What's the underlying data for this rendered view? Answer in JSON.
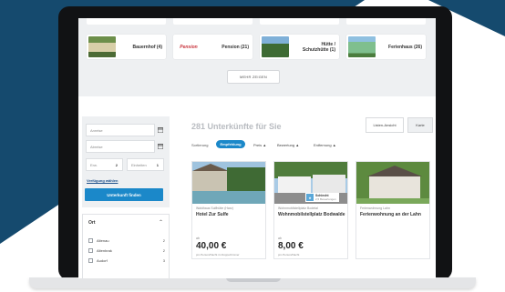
{
  "colors": {
    "navy": "#154a6e",
    "accent": "#1b88c9",
    "panel": "#eef0f2"
  },
  "categories": [
    {
      "label": "Bauernhof (4)",
      "thumb": "house-photo"
    },
    {
      "label": "Pension (21)",
      "thumb": "pension-logo"
    },
    {
      "label": "Hütte / Schutzhütte (1)",
      "thumb": "hut-photo"
    },
    {
      "label": "Ferienhaus (26)",
      "thumb": "green-house-photo"
    }
  ],
  "more_button": "MEHR ZEIGEN",
  "pension_logo_text": "Pension",
  "search": {
    "arrival": "Anreise",
    "departure": "Abreise",
    "adults_label": "Erw.",
    "adults_value": "2",
    "rooms_label": "Einheiten",
    "rooms_value": "1",
    "availability_link": "Verfügung wählen",
    "button": "Unterkunft finden"
  },
  "filter": {
    "title": "Ort",
    "items": [
      {
        "label": "Altenau",
        "count": "2"
      },
      {
        "label": "Altenbrak",
        "count": "2"
      },
      {
        "label": "Audorf",
        "count": "3"
      }
    ]
  },
  "results": {
    "title": "281 Unterkünfte für Sie",
    "view_list": "Listen-Ansicht",
    "view_map": "Karte",
    "sort_label": "Sortierung",
    "sort_active": "Empfehlung",
    "sort_options": [
      "Preis",
      "Bewertung",
      "Entfernung"
    ]
  },
  "cards": [
    {
      "location": "Waldhaus Sulfhütte (Harz)",
      "title": "Hotel Zur Sulfe",
      "from": "ab",
      "price": "40,00 €",
      "per": "pro Person/Nacht im Doppelzimmer"
    },
    {
      "location": "Wohnmobilstellplatz Bodetal",
      "title": "Wohnmobilstellplatz Bodwalde",
      "from": "ab",
      "price": "8,00 €",
      "per": "pro Person/Nacht",
      "badge_title": "Schlecht",
      "badge_sub": "2,5 Bewertungen"
    },
    {
      "location": "Ferienwohnung Lahn",
      "title": "Ferienwohnung an der Lahn",
      "from": "",
      "price": "",
      "per": ""
    }
  ]
}
